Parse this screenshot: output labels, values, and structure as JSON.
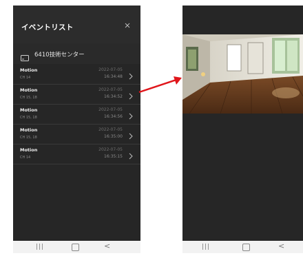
{
  "event_list": {
    "title": "イベントリスト",
    "device": "6410技術センター",
    "items": [
      {
        "title": "Motion",
        "channel": "CH 14",
        "date": "2022-07-05",
        "time": "16:34:48"
      },
      {
        "title": "Motion",
        "channel": "CH 15, 18",
        "date": "2022-07-05",
        "time": "16:34:52"
      },
      {
        "title": "Motion",
        "channel": "CH 15, 18",
        "date": "2022-07-05",
        "time": "16:34:56"
      },
      {
        "title": "Motion",
        "channel": "CH 15, 18",
        "date": "2022-07-05",
        "time": "16:35:00"
      },
      {
        "title": "Motion",
        "channel": "CH 14",
        "date": "2022-07-05",
        "time": "16:35:15"
      }
    ]
  },
  "nav": {
    "recents": "|||",
    "back": "<"
  },
  "colors": {
    "background": "#262626",
    "arrow": "#e0161b",
    "nav": "#f2f2f2"
  }
}
